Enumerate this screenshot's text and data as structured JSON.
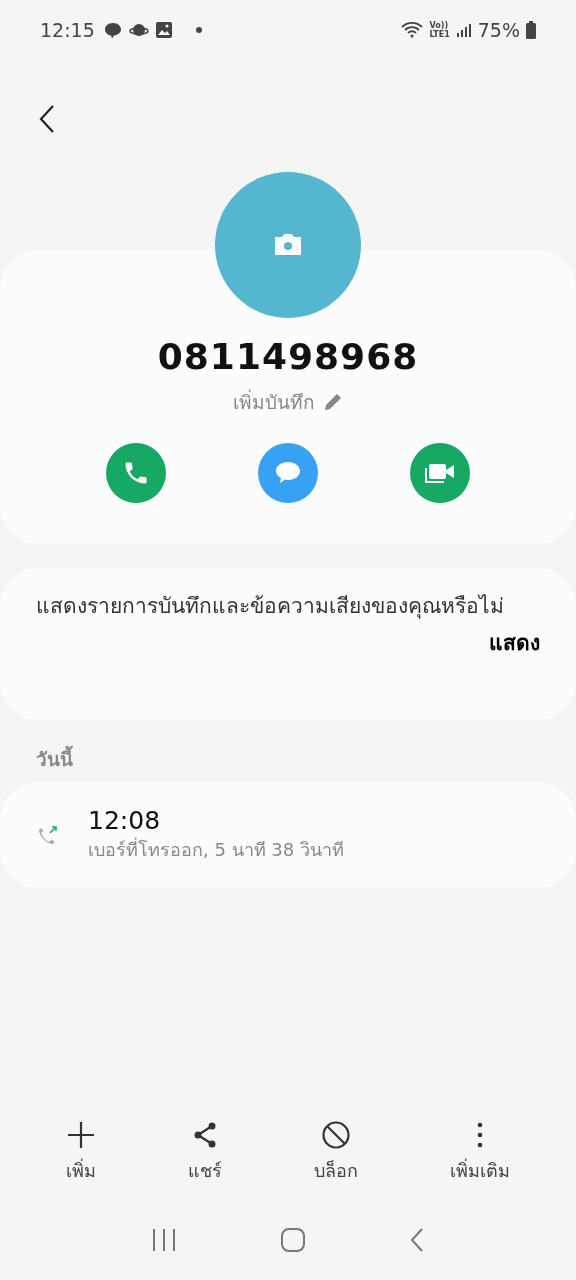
{
  "status_bar": {
    "time": "12:15",
    "network_top": "Vo))",
    "network_bottom": "LTE1",
    "battery": "75%"
  },
  "contact": {
    "number": "0811498968",
    "note_placeholder": "เพิ่มบันทึก",
    "actions": [
      {
        "kind": "call"
      },
      {
        "kind": "message"
      },
      {
        "kind": "video"
      }
    ]
  },
  "prompt": {
    "text": "แสดงรายการบันทึกและข้อความเสียงของคุณหรือไม่",
    "button": "แสดง"
  },
  "history": {
    "section": "วันนี้",
    "calls": [
      {
        "kind": "outgoing",
        "time": "12:08",
        "detail": "เบอร์ที่โทรออก, 5 นาที 38 วินาที"
      }
    ]
  },
  "bottom_actions": [
    {
      "kind": "add",
      "label": "เพิ่ม"
    },
    {
      "kind": "share",
      "label": "แชร์"
    },
    {
      "kind": "block",
      "label": "บล็อก"
    },
    {
      "kind": "more",
      "label": "เพิ่มเติม"
    }
  ]
}
